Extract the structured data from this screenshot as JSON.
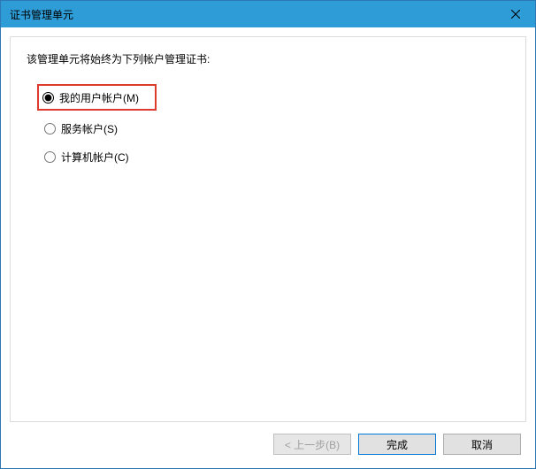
{
  "titlebar": {
    "title": "证书管理单元",
    "close_icon": "close"
  },
  "content": {
    "instruction": "该管理单元将始终为下列帐户管理证书:",
    "radios": [
      {
        "label": "我的用户帐户(M)",
        "checked": true,
        "highlighted": true
      },
      {
        "label": "服务帐户(S)",
        "checked": false,
        "highlighted": false
      },
      {
        "label": "计算机帐户(C)",
        "checked": false,
        "highlighted": false
      }
    ]
  },
  "buttons": {
    "back": "< 上一步(B)",
    "finish": "完成",
    "cancel": "取消"
  }
}
